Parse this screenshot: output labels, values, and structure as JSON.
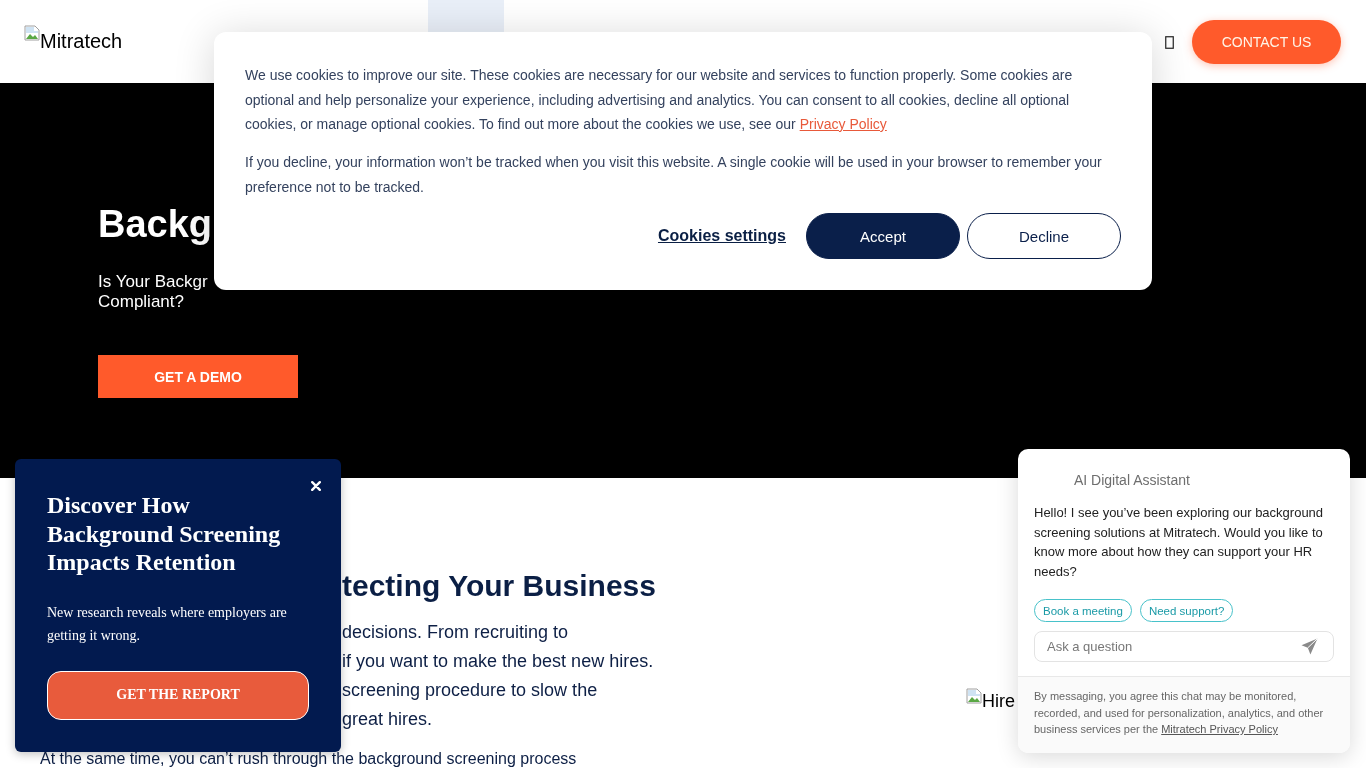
{
  "header": {
    "logo_alt": "Mitratech",
    "contact_button": "CONTACT US"
  },
  "hero": {
    "title": "Backg",
    "subtitle_lines": [
      "Is Your Backgr",
      "Compliant?"
    ],
    "cta_button": "GET A DEMO"
  },
  "content": {
    "heading": "tecting Your Business",
    "paragraph_lines": [
      "decisions. From recruiting to",
      "if you want to make the best new hires.",
      "screening procedure to slow the",
      "great hires."
    ],
    "next_paragraph": "At the same time, you can’t rush through the background screening process",
    "image_alt": "Hire"
  },
  "cookie_banner": {
    "paragraphs": [
      {
        "text": "We use cookies to improve our site. These cookies are necessary for our website and services to function properly. Some cookies are optional and help personalize your experience, including advertising and analytics. You can consent to all cookies, decline all optional cookies, or manage optional cookies. To find out more about the cookies we use, see our",
        "link": "Privacy Policy"
      },
      {
        "text": "If you decline, your information won’t be tracked when you visit this website. A single cookie will be used in your browser to remember your preference not to be tracked."
      }
    ],
    "buttons": [
      {
        "label": "Cookies settings",
        "kind": "link"
      },
      {
        "label": "Accept",
        "kind": "primary"
      },
      {
        "label": "Decline",
        "kind": "outline"
      }
    ]
  },
  "promo_popup": {
    "title": "Discover How Background Screening Impacts Retention",
    "text": "New research reveals where employers are getting it wrong.",
    "button": "GET THE REPORT"
  },
  "chat_widget": {
    "title": "AI Digital Assistant",
    "message": "Hello! I see you’ve been exploring our background screening solutions at Mitratech. Would you like to know more about how they can support your HR needs?",
    "quick_replies": [
      "Book a meeting",
      "Need support?"
    ],
    "input": {
      "placeholder": "Ask a question"
    },
    "disclaimer": {
      "text": "By messaging, you agree this chat may be monitored, recorded, and used for personalization, analytics, and other business services per the",
      "link": "Mitratech Privacy Policy"
    }
  }
}
